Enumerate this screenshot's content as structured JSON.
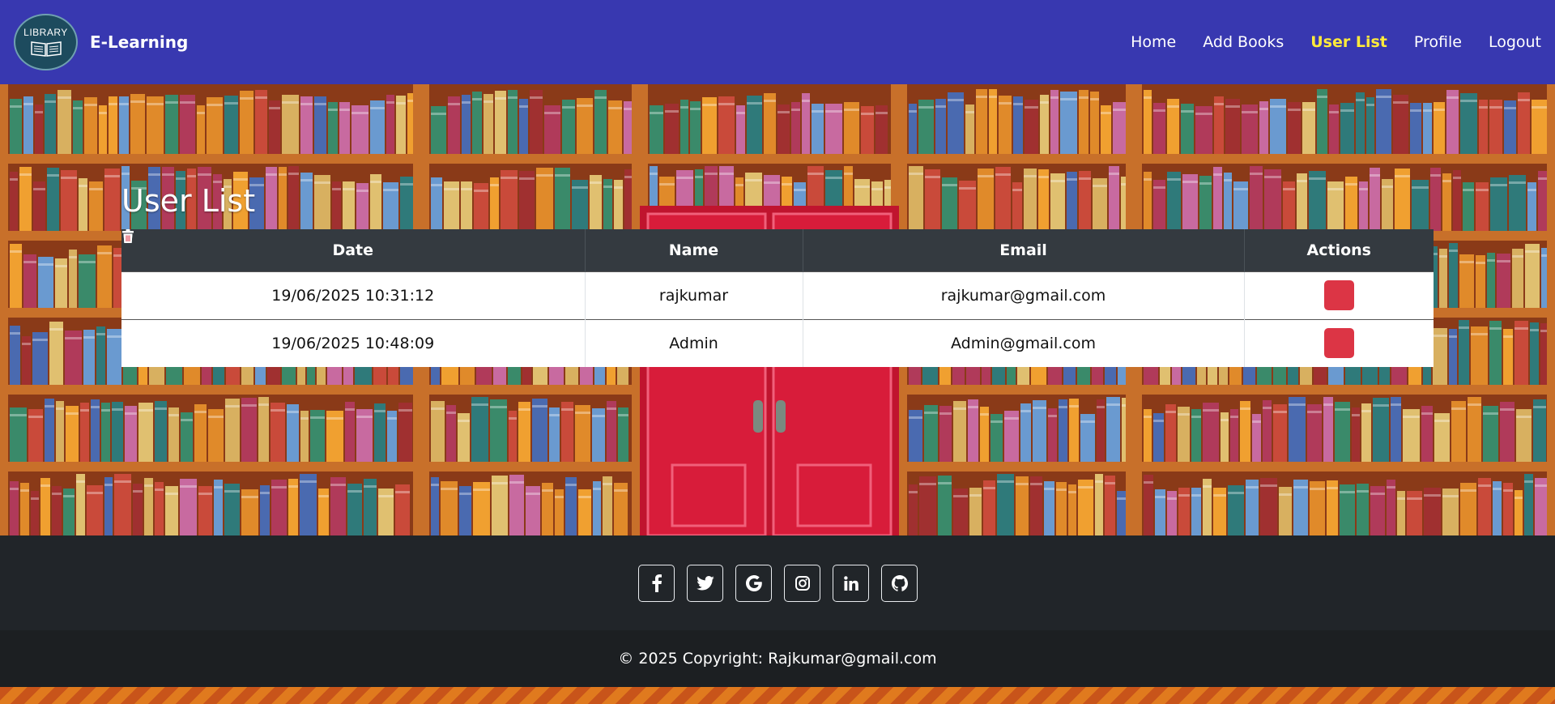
{
  "navbar": {
    "logo_text": "LIBRARY",
    "brand_name": "E-Learning",
    "links": [
      "Home",
      "Add Books",
      "User List",
      "Profile",
      "Logout"
    ],
    "active_link": "User List"
  },
  "page": {
    "title": "User List"
  },
  "table": {
    "headers": [
      "Date",
      "Name",
      "Email",
      "Actions"
    ],
    "rows": [
      {
        "date": "19/06/2025 10:31:12",
        "name": "rajkumar",
        "email": "rajkumar@gmail.com",
        "action_icon": "trash-icon"
      },
      {
        "date": "19/06/2025 10:48:09",
        "name": "Admin",
        "email": "Admin@gmail.com",
        "action_icon": "trash-icon"
      }
    ]
  },
  "footer": {
    "social_icons": [
      "facebook-icon",
      "twitter-icon",
      "google-icon",
      "instagram-icon",
      "linkedin-icon",
      "github-icon"
    ],
    "copyright": "© 2025 Copyright: Rajkumar@gmail.com"
  },
  "colors": {
    "navbar_bg": "#3838b0",
    "active_link": "#ffeb3b",
    "table_header_bg": "#343a40",
    "delete_button": "#dc3545",
    "footer_bg": "#212529",
    "copyright_bg": "#1c1f22"
  }
}
